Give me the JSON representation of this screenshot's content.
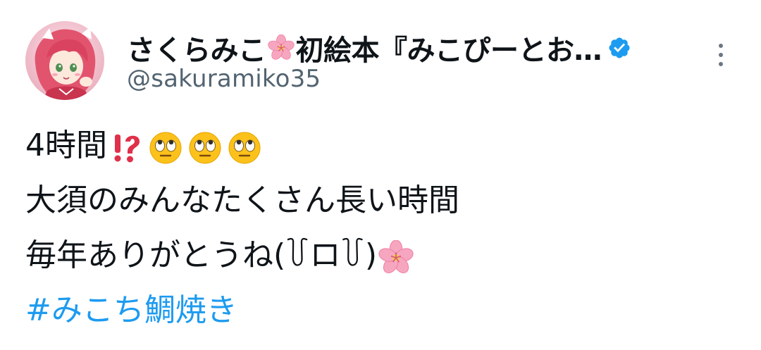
{
  "author": {
    "display_name_part1": "さくらみこ",
    "display_name_part2": "初絵本『みこぴーとお…",
    "name_emoji": "sakura-flower-icon",
    "handle": "@sakuramiko35",
    "verified": true,
    "verified_color": "#1d9bf0"
  },
  "tweet": {
    "line1_text": "4時間",
    "line1_emojis": [
      "exclamation-question-icon",
      "face-with-rolling-eyes-icon",
      "face-with-rolling-eyes-icon",
      "face-with-rolling-eyes-icon"
    ],
    "line2_text": "大須のみんなたくさん長い時間",
    "line3_text": "毎年ありがとうね(꒦ロ꒦)",
    "line3_emoji": "sakura-flower-icon",
    "hashtag": "#みこち鯛焼き"
  },
  "colors": {
    "text": "#0f1419",
    "secondary": "#536471",
    "link": "#1d9bf0"
  }
}
